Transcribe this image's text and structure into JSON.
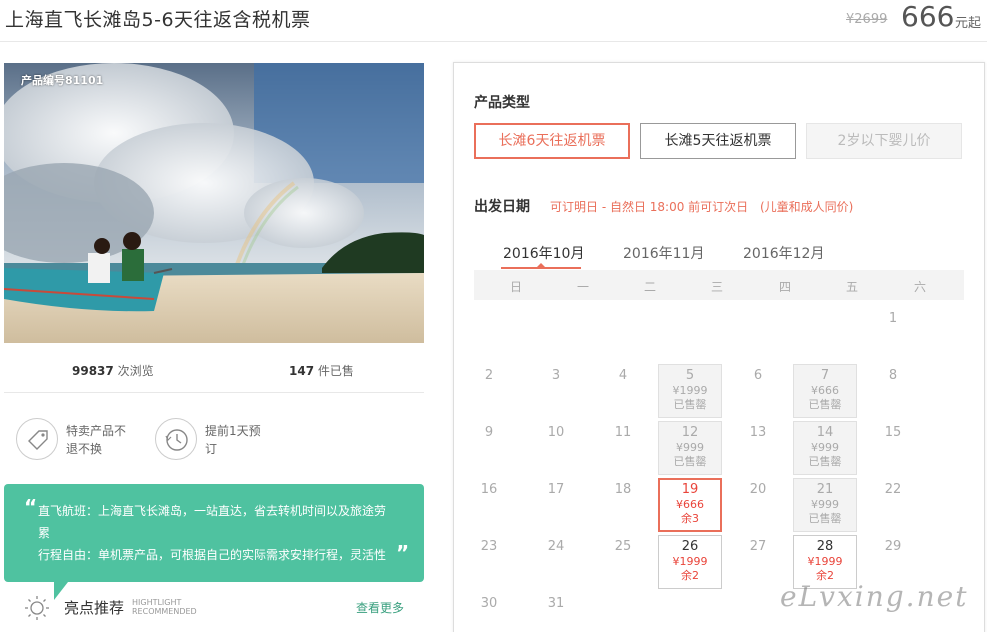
{
  "header": {
    "title": "上海直飞长滩岛5-6天往返含税机票",
    "price_original": "¥2699",
    "price_current": "666",
    "price_unit": "元起"
  },
  "photo": {
    "product_no": "产品编号81101"
  },
  "stats": {
    "views_count": "99837",
    "views_label": "次浏览",
    "sold_count": "147",
    "sold_label": "件已售"
  },
  "features": [
    {
      "icon": "tag-icon",
      "line1": "特卖产品不",
      "line2": "退不换"
    },
    {
      "icon": "clock-history-icon",
      "line1": "提前1天预",
      "line2": "订"
    }
  ],
  "highlights": {
    "line1": "直飞航班：上海直飞长滩岛，一站直达，省去转机时间以及旅途劳",
    "line1b": "累",
    "line2": "行程自由：单机票产品，可根据自己的实际需求安排行程，灵活性",
    "title": "亮点推荐",
    "en1": "HIGHTLIGHT",
    "en2": "RECOMMENDED",
    "more": "查看更多",
    "accent": "#4fc2a0"
  },
  "product_type": {
    "title": "产品类型",
    "options": [
      {
        "label": "长滩6天往返机票",
        "state": "selected"
      },
      {
        "label": "长滩5天往返机票",
        "state": "normal"
      },
      {
        "label": "2岁以下婴儿价",
        "state": "disabled"
      }
    ]
  },
  "departure": {
    "title": "出发日期",
    "note": "可订明日 - 自然日 18:00 前可订次日",
    "note2": "(儿童和成人同价)",
    "months": [
      "2016年10月",
      "2016年11月",
      "2016年12月"
    ],
    "active_month": "2016年10月",
    "weekdays": [
      "日",
      "一",
      "二",
      "三",
      "四",
      "五",
      "六"
    ],
    "days": [
      {
        "d": "1"
      },
      {
        "d": "2"
      },
      {
        "d": "3"
      },
      {
        "d": "4"
      },
      {
        "d": "5",
        "price": "¥1999",
        "status": "已售罄",
        "type": "soldout"
      },
      {
        "d": "6"
      },
      {
        "d": "7",
        "price": "¥666",
        "status": "已售罄",
        "type": "soldout"
      },
      {
        "d": "8"
      },
      {
        "d": "9"
      },
      {
        "d": "10"
      },
      {
        "d": "11"
      },
      {
        "d": "12",
        "price": "¥999",
        "status": "已售罄",
        "type": "soldout"
      },
      {
        "d": "13"
      },
      {
        "d": "14",
        "price": "¥999",
        "status": "已售罄",
        "type": "soldout"
      },
      {
        "d": "15"
      },
      {
        "d": "16"
      },
      {
        "d": "17"
      },
      {
        "d": "18"
      },
      {
        "d": "19",
        "price": "¥666",
        "status": "余3",
        "type": "selected"
      },
      {
        "d": "20"
      },
      {
        "d": "21",
        "price": "¥999",
        "status": "已售罄",
        "type": "soldout"
      },
      {
        "d": "22"
      },
      {
        "d": "23"
      },
      {
        "d": "24"
      },
      {
        "d": "25"
      },
      {
        "d": "26",
        "price": "¥1999",
        "status": "余2",
        "type": "available"
      },
      {
        "d": "27"
      },
      {
        "d": "28",
        "price": "¥1999",
        "status": "余2",
        "type": "available"
      },
      {
        "d": "29"
      },
      {
        "d": "30"
      },
      {
        "d": "31"
      }
    ],
    "accent": "#ea6f5a"
  },
  "watermark": "eLvxing.net"
}
